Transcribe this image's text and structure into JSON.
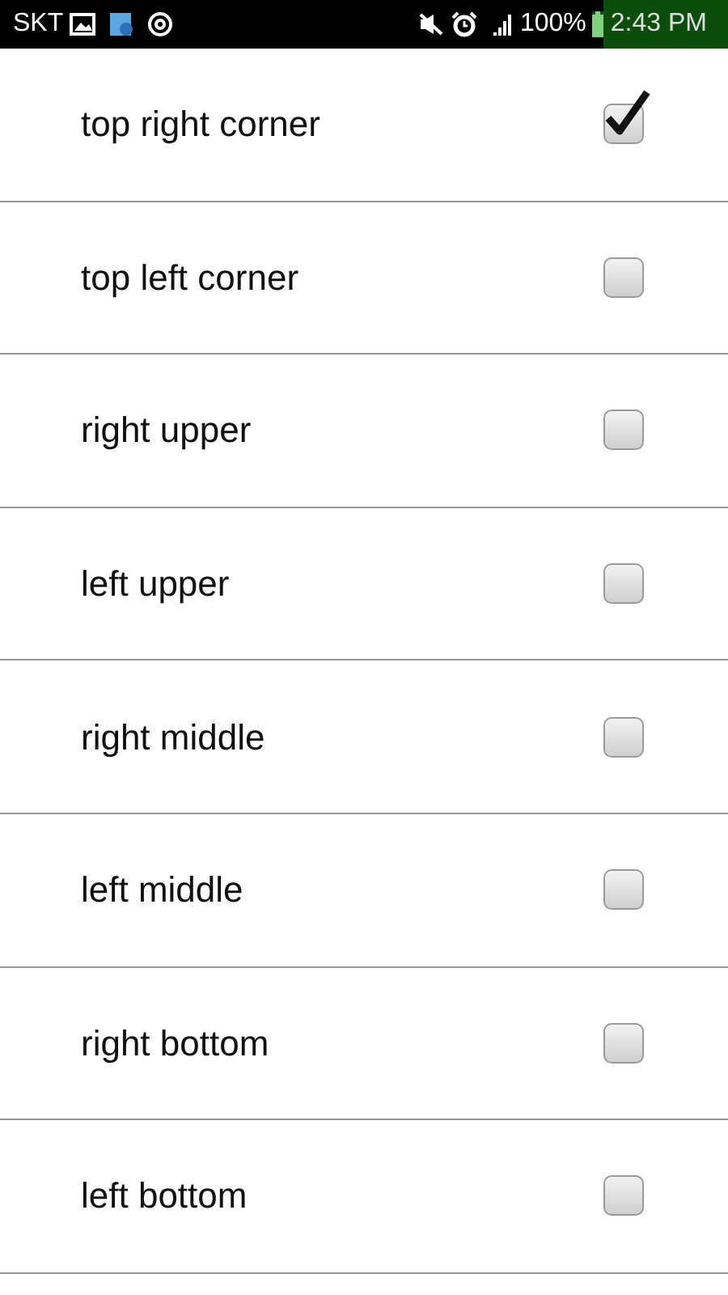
{
  "status_bar": {
    "carrier": "SKT",
    "battery": "100%",
    "time": "2:43 PM"
  },
  "items": [
    {
      "label": "top right corner",
      "checked": true
    },
    {
      "label": "top left corner",
      "checked": false
    },
    {
      "label": "right upper",
      "checked": false
    },
    {
      "label": "left upper",
      "checked": false
    },
    {
      "label": "right middle",
      "checked": false
    },
    {
      "label": "left middle",
      "checked": false
    },
    {
      "label": "right bottom",
      "checked": false
    },
    {
      "label": "left bottom",
      "checked": false
    }
  ]
}
